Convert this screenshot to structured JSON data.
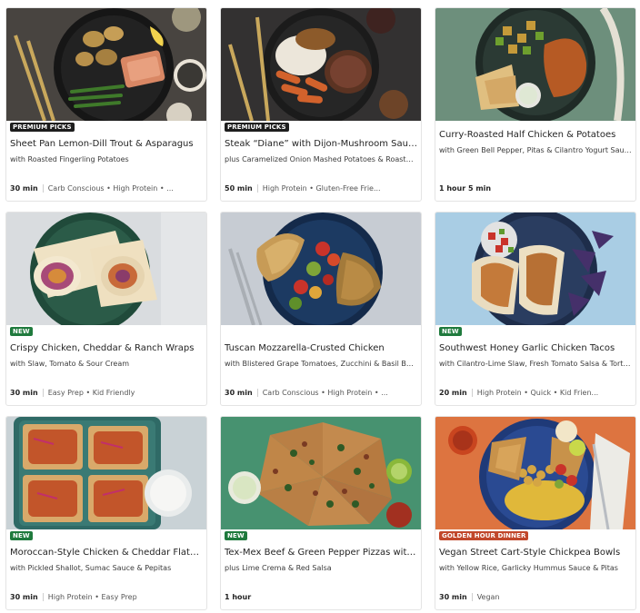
{
  "recipes": [
    {
      "badge": "PREMIUM PICKS",
      "title": "Sheet Pan Lemon-Dill Trout & Asparagus",
      "subtitle": "with Roasted Fingerling Potatoes",
      "time": "30 min",
      "tags": "Carb Conscious • High Protein • ..."
    },
    {
      "badge": "PREMIUM PICKS",
      "title": "Steak “Diane” with Dijon-Mushroom Sauce",
      "subtitle": "plus Caramelized Onion Mashed Potatoes & Roasted...",
      "time": "50 min",
      "tags": "High Protein • Gluten-Free Frie..."
    },
    {
      "badge": "",
      "title": "Curry-Roasted Half Chicken & Potatoes",
      "subtitle": "with Green Bell Pepper, Pitas & Cilantro Yogurt Sauce",
      "time": "1 hour 5 min",
      "tags": ""
    },
    {
      "badge": "NEW",
      "title": "Crispy Chicken, Cheddar & Ranch Wraps",
      "subtitle": "with Slaw, Tomato & Sour Cream",
      "time": "30 min",
      "tags": "Easy Prep • Kid Friendly"
    },
    {
      "badge": "",
      "title": "Tuscan Mozzarella-Crusted Chicken",
      "subtitle": "with Blistered Grape Tomatoes, Zucchini & Basil Bu...",
      "time": "30 min",
      "tags": "Carb Conscious • High Protein • ..."
    },
    {
      "badge": "NEW",
      "title": "Southwest Honey Garlic Chicken Tacos",
      "subtitle": "with Cilantro-Lime Slaw, Fresh Tomato Salsa & Torti...",
      "time": "20 min",
      "tags": "High Protein • Quick • Kid Frien..."
    },
    {
      "badge": "NEW",
      "title": "Moroccan-Style Chicken & Cheddar Flatbre...",
      "subtitle": "with Pickled Shallot, Sumac Sauce & Pepitas",
      "time": "30 min",
      "tags": "High Protein • Easy Prep"
    },
    {
      "badge": "NEW",
      "title": "Tex-Mex Beef & Green Pepper Pizzas with ...",
      "subtitle": "plus Lime Crema & Red Salsa",
      "time": "1 hour",
      "tags": ""
    },
    {
      "badge": "GOLDEN HOUR DINNER",
      "title": "Vegan Street Cart-Style Chickpea Bowls",
      "subtitle": "with Yellow Rice, Garlicky Hummus Sauce & Pitas",
      "time": "30 min",
      "tags": "Vegan"
    }
  ],
  "colors": {
    "premium_badge": "#1e1e1e",
    "new_badge": "#1f7a3d",
    "golden_badge": "#c1472b"
  }
}
